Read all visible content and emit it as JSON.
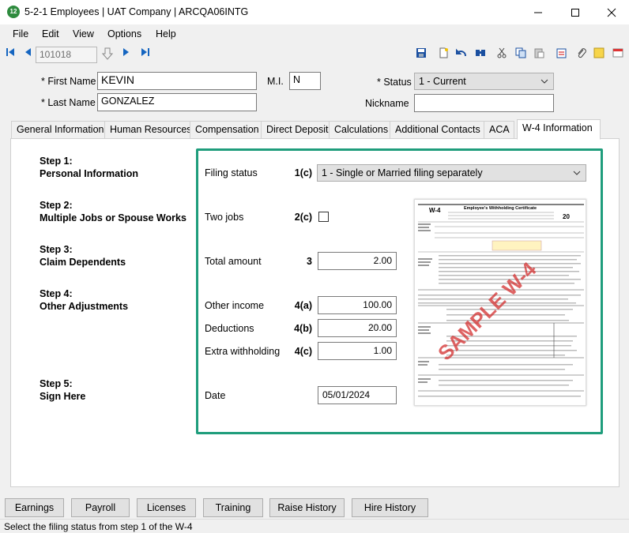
{
  "window": {
    "title": "5-2-1 Employees  |  UAT Company  |  ARCQA06INTG",
    "app_icon_label": "12"
  },
  "menu": [
    "File",
    "Edit",
    "View",
    "Options",
    "Help"
  ],
  "toolbar": {
    "record_id": "101018"
  },
  "employee": {
    "first_name_label": "* First Name",
    "first_name": "KEVIN",
    "mi_label": "M.I.",
    "mi": "N",
    "last_name_label": "* Last Name",
    "last_name": "GONZALEZ",
    "status_label": "* Status",
    "status": "1 - Current",
    "nickname_label": "Nickname",
    "nickname": ""
  },
  "tabs": [
    "General Information",
    "Human Resources",
    "Compensation",
    "Direct Deposit",
    "Calculations",
    "Additional Contacts",
    "ACA",
    "W-4 Information"
  ],
  "active_tab": "W-4 Information",
  "steps": [
    {
      "title": "Step 1:",
      "subtitle": "Personal Information"
    },
    {
      "title": "Step 2:",
      "subtitle": "Multiple Jobs or Spouse Works"
    },
    {
      "title": "Step 3:",
      "subtitle": "Claim Dependents"
    },
    {
      "title": "Step 4:",
      "subtitle": "Other Adjustments"
    },
    {
      "title": "Step 5:",
      "subtitle": "Sign Here"
    }
  ],
  "w4": {
    "filing_status": {
      "label": "Filing status",
      "code": "1(c)",
      "value": "1 - Single or Married filing separately"
    },
    "two_jobs": {
      "label": "Two jobs",
      "code": "2(c)",
      "checked": false
    },
    "total_amount": {
      "label": "Total amount",
      "code": "3",
      "value": "2.00"
    },
    "other_income": {
      "label": "Other income",
      "code": "4(a)",
      "value": "100.00"
    },
    "deductions": {
      "label": "Deductions",
      "code": "4(b)",
      "value": "20.00"
    },
    "extra_withholding": {
      "label": "Extra withholding",
      "code": "4(c)",
      "value": "1.00"
    },
    "date": {
      "label": "Date",
      "value": "05/01/2024"
    }
  },
  "w4_thumbnail": {
    "form": "W-4",
    "heading": "Employee's Withholding Certificate",
    "year": "20",
    "watermark": "SAMPLE W-4"
  },
  "bottom_buttons": [
    "Earnings",
    "Payroll",
    "Licenses",
    "Training",
    "Raise History",
    "Hire History"
  ],
  "status_bar": "Select the filing status from step 1 of the W-4",
  "colors": {
    "highlight": "#1f9d7c",
    "toolbar_blue": "#1565c0",
    "watermark": "#d32f2f"
  }
}
